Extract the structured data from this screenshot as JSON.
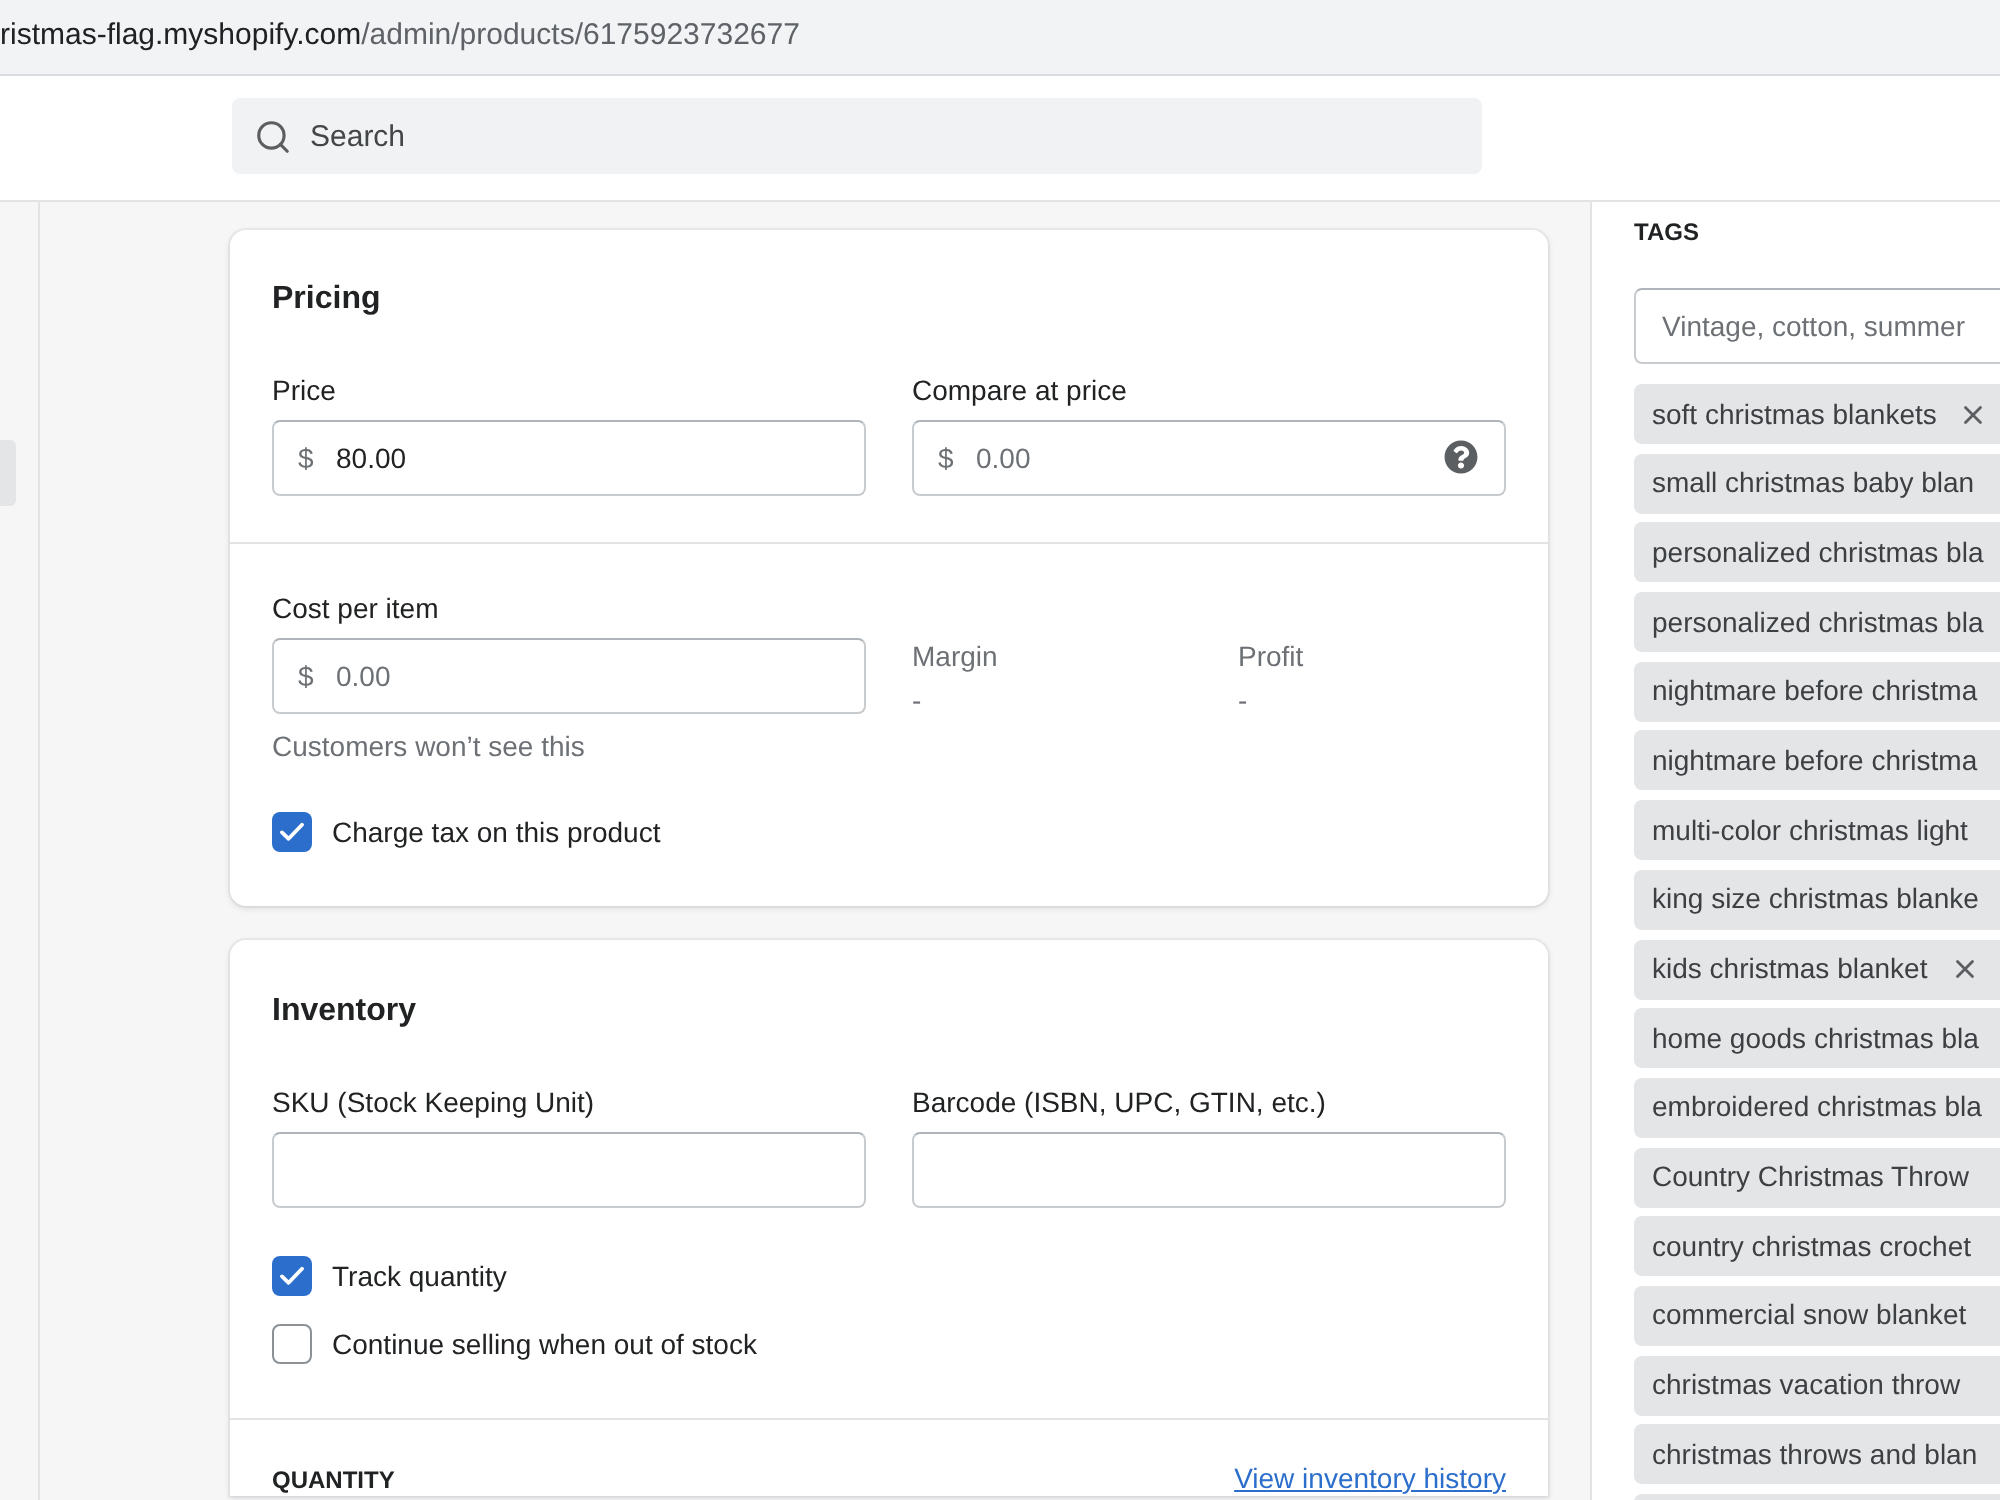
{
  "address_bar": {
    "host": "ristmas-flag.myshopify.com",
    "path": "/admin/products/6175923732677"
  },
  "top_bar": {
    "search": {
      "placeholder": "Search"
    }
  },
  "sidebar": {
    "items": [
      {
        "selected": true
      }
    ]
  },
  "pricing": {
    "title": "Pricing",
    "price": {
      "label": "Price",
      "prefix": "$",
      "value": "80.00"
    },
    "compare_at_price": {
      "label": "Compare at price",
      "prefix": "$",
      "placeholder": "0.00"
    },
    "cost_per_item": {
      "label": "Cost per item",
      "prefix": "$",
      "placeholder": "0.00",
      "help_text": "Customers won’t see this"
    },
    "margin": {
      "label": "Margin",
      "value": "-"
    },
    "profit": {
      "label": "Profit",
      "value": "-"
    },
    "charge_tax": {
      "label": "Charge tax on this product",
      "checked": true
    }
  },
  "inventory": {
    "title": "Inventory",
    "sku": {
      "label": "SKU (Stock Keeping Unit)"
    },
    "barcode": {
      "label": "Barcode (ISBN, UPC, GTIN, etc.)"
    },
    "options": [
      {
        "label": "Track quantity",
        "checked": true
      },
      {
        "label": "Continue selling when out of stock",
        "checked": false
      }
    ],
    "quantity": {
      "heading": "QUANTITY",
      "link": "View inventory history"
    }
  },
  "tags": {
    "heading": "TAGS",
    "input": {
      "placeholder": "Vintage, cotton, summer"
    },
    "items": [
      {
        "label": "soft christmas blankets",
        "remove_button": true
      },
      {
        "label": "small christmas baby blan",
        "remove_button": false
      },
      {
        "label": "personalized christmas bla",
        "remove_button": false
      },
      {
        "label": "personalized christmas bla",
        "remove_button": false
      },
      {
        "label": "nightmare before christma",
        "remove_button": false
      },
      {
        "label": "nightmare before christma",
        "remove_button": false
      },
      {
        "label": "multi-color christmas light",
        "remove_button": false
      },
      {
        "label": "king size christmas blanke",
        "remove_button": false
      },
      {
        "label": "kids christmas blanket",
        "remove_button": true
      },
      {
        "label": "home goods christmas bla",
        "remove_button": false
      },
      {
        "label": "embroidered christmas bla",
        "remove_button": false
      },
      {
        "label": "Country Christmas Throw",
        "remove_button": false
      },
      {
        "label": "country christmas crochet",
        "remove_button": false
      },
      {
        "label": "commercial snow blanket",
        "remove_button": false
      },
      {
        "label": "christmas vacation throw",
        "remove_button": false
      },
      {
        "label": "christmas throws and blan",
        "remove_button": false
      }
    ]
  }
}
